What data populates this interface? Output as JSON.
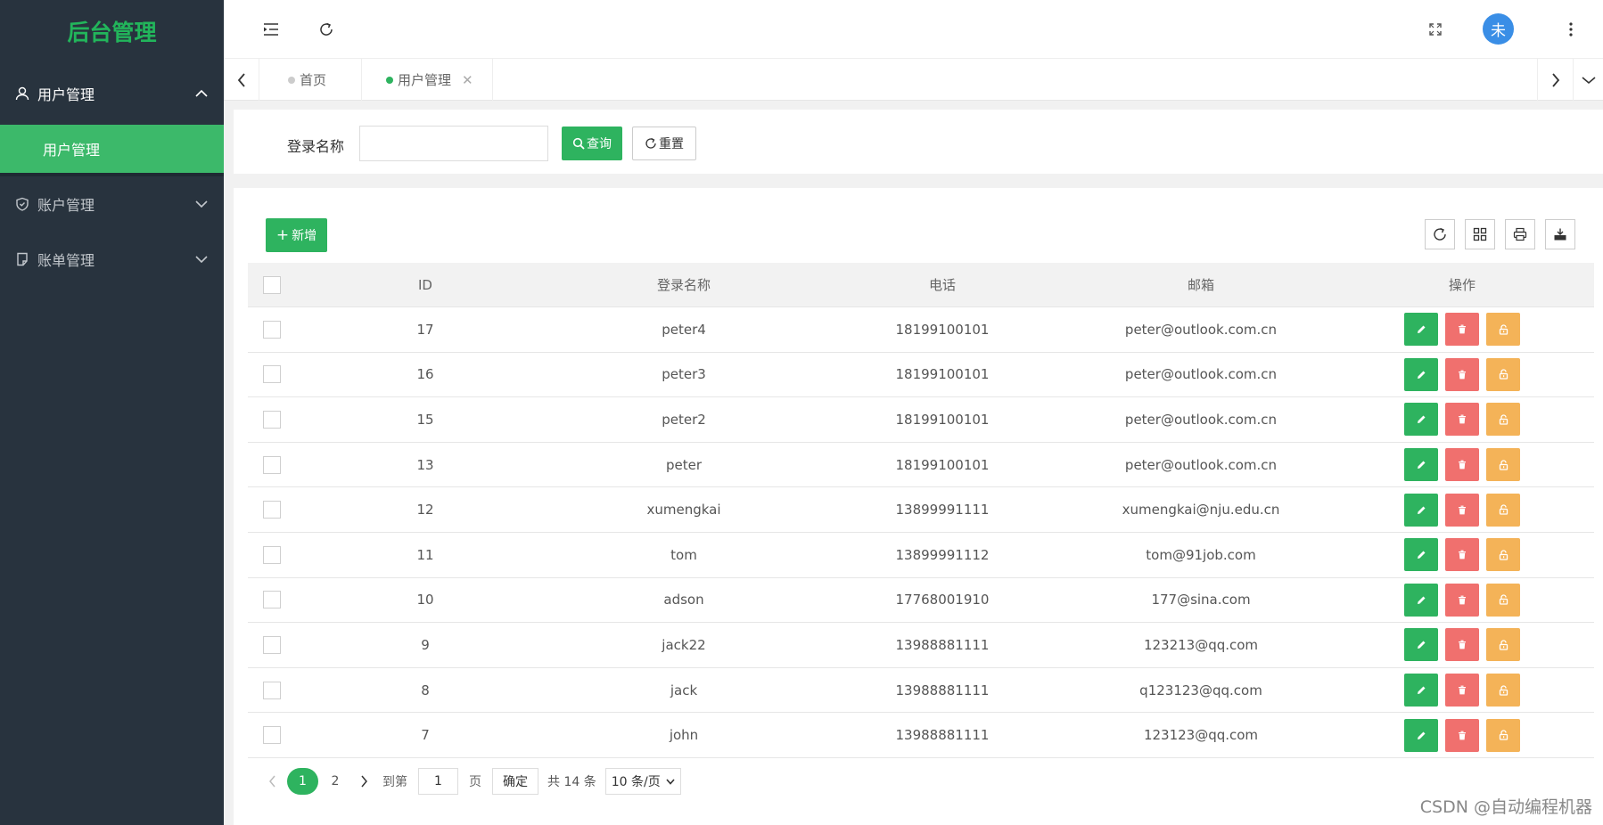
{
  "app": {
    "title": "后台管理"
  },
  "sidebar": {
    "items": [
      {
        "label": "用户管理",
        "icon": "user-icon",
        "expanded": true
      },
      {
        "label": "账户管理",
        "icon": "shield-icon",
        "expanded": false
      },
      {
        "label": "账单管理",
        "icon": "bill-icon",
        "expanded": false
      }
    ],
    "active_sub": "用户管理"
  },
  "topbar": {
    "avatar_text": "未"
  },
  "tabs": [
    {
      "label": "首页",
      "active": false
    },
    {
      "label": "用户管理",
      "active": true
    }
  ],
  "search": {
    "label": "登录名称",
    "value": "",
    "query_label": "查询",
    "reset_label": "重置"
  },
  "toolbar": {
    "add_label": "新增"
  },
  "table": {
    "columns": [
      "ID",
      "登录名称",
      "电话",
      "邮箱",
      "操作"
    ],
    "rows": [
      {
        "id": "17",
        "name": "peter4",
        "tel": "18199100101",
        "mail": "peter@outlook.com.cn"
      },
      {
        "id": "16",
        "name": "peter3",
        "tel": "18199100101",
        "mail": "peter@outlook.com.cn"
      },
      {
        "id": "15",
        "name": "peter2",
        "tel": "18199100101",
        "mail": "peter@outlook.com.cn"
      },
      {
        "id": "13",
        "name": "peter",
        "tel": "18199100101",
        "mail": "peter@outlook.com.cn"
      },
      {
        "id": "12",
        "name": "xumengkai",
        "tel": "13899991111",
        "mail": "xumengkai@nju.edu.cn"
      },
      {
        "id": "11",
        "name": "tom",
        "tel": "13899991112",
        "mail": "tom@91job.com"
      },
      {
        "id": "10",
        "name": "adson",
        "tel": "17768001910",
        "mail": "177@sina.com"
      },
      {
        "id": "9",
        "name": "jack22",
        "tel": "13988881111",
        "mail": "123213@qq.com"
      },
      {
        "id": "8",
        "name": "jack",
        "tel": "13988881111",
        "mail": "q123123@qq.com"
      },
      {
        "id": "7",
        "name": "john",
        "tel": "13988881111",
        "mail": "123123@qq.com"
      }
    ]
  },
  "pagination": {
    "pages": [
      "1",
      "2"
    ],
    "current": "1",
    "goto_prefix": "到第",
    "goto_value": "1",
    "goto_suffix": "页",
    "confirm_label": "确定",
    "total_text": "共 14 条",
    "page_size": "10 条/页"
  },
  "watermark": "CSDN @自动编程机器",
  "colors": {
    "primary": "#2eb35f",
    "danger": "#f0706e",
    "warning": "#f4b358",
    "sidebar_bg": "#28333e",
    "avatar": "#3a8ee6"
  }
}
